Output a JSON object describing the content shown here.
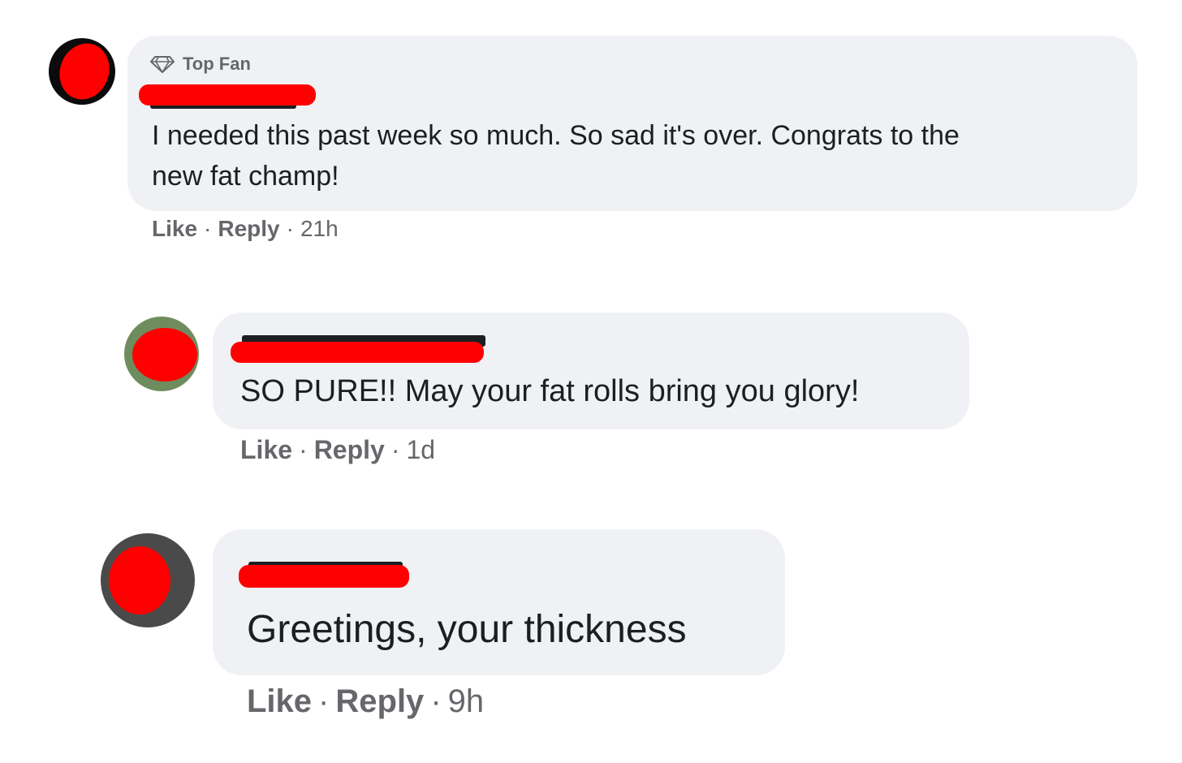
{
  "comments": [
    {
      "badge": "Top Fan",
      "badge_icon": "diamond-icon",
      "text_lines": [
        "I needed this past week so much. So sad it's over. Congrats to the",
        "new fat champ!"
      ],
      "actions": {
        "like": "Like",
        "reply": "Reply",
        "time": "21h"
      }
    },
    {
      "text_lines": [
        "SO PURE!! May your fat rolls bring you glory!"
      ],
      "actions": {
        "like": "Like",
        "reply": "Reply",
        "time": "1d"
      }
    },
    {
      "text_lines": [
        "Greetings, your thickness"
      ],
      "actions": {
        "like": "Like",
        "reply": "Reply",
        "time": "9h"
      }
    }
  ],
  "colors": {
    "bubble": "#f0f1f4",
    "redaction": "#ff0000",
    "meta_text": "#65676b",
    "body_text": "#1c1e21"
  }
}
